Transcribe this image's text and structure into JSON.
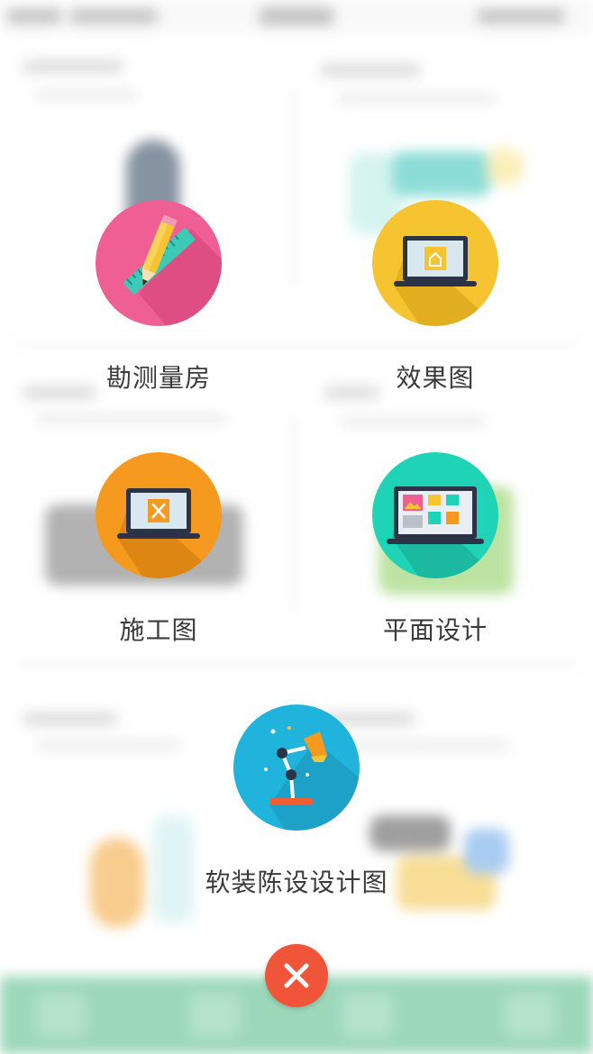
{
  "colors": {
    "pink": "#f05f93",
    "yellow": "#f6c431",
    "orange": "#f59a1f",
    "teal": "#1fd3b6",
    "blue": "#20b3dc",
    "close": "#f0553a",
    "tabbar": "#55bb88"
  },
  "menu": {
    "items": [
      {
        "label": "勘测量房",
        "icon": "ruler-pencil-icon"
      },
      {
        "label": "效果图",
        "icon": "laptop-house-icon"
      },
      {
        "label": "施工图",
        "icon": "laptop-tools-icon"
      },
      {
        "label": "平面设计",
        "icon": "laptop-grid-icon"
      },
      {
        "label": "软装陈设设计图",
        "icon": "desk-lamp-icon"
      }
    ],
    "close_icon": "close-icon"
  }
}
